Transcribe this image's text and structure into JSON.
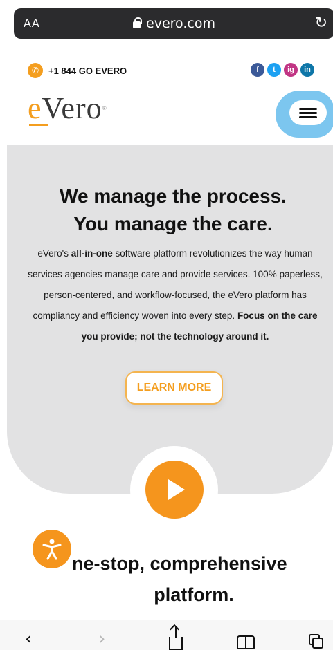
{
  "browser": {
    "text_size_label": "AA",
    "url": "evero.com",
    "icons": [
      "lock-icon",
      "reload-icon"
    ]
  },
  "contact": {
    "phone": "+1 844 GO EVERO",
    "social": [
      "f",
      "t",
      "ig",
      "in"
    ]
  },
  "logo": {
    "text": "eVero",
    "colors": {
      "e": "#f49e1f",
      "rest": "#3a3a3a"
    }
  },
  "hero": {
    "title_line1": "We manage the process.",
    "title_line2": "You manage the care.",
    "body": {
      "part1": "eVero's ",
      "bold1": "all-in-one",
      "part2": " software platform revolutionizes the way human services agencies manage care and provide services. 100% paperless, person-centered, and workflow-focused, the eVero platform has compliancy and efficiency woven into every step. ",
      "bold2": "Focus on the care you provide; not the technology around it."
    },
    "cta_label": "LEARN MORE",
    "accent": "#f5951d",
    "background": "#e2e2e3"
  },
  "section": {
    "title_line1": "ne-stop, comprehensive",
    "title_line2": "platform."
  },
  "toolbar": {
    "back": "‹",
    "forward": "›"
  }
}
